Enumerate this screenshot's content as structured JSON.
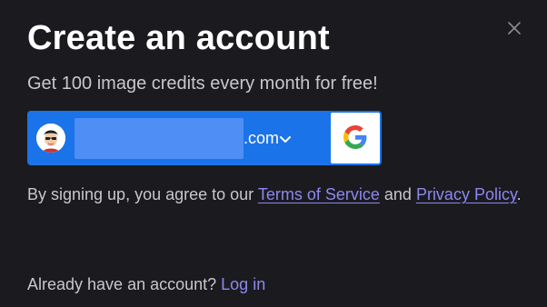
{
  "dialog": {
    "title": "Create an account",
    "subtitle": "Get 100 image credits every month for free!",
    "close_icon": "close-icon"
  },
  "google_signin": {
    "account_email_suffix": ".com",
    "avatar_icon": "user-avatar",
    "chevron_icon": "chevron-down-icon",
    "provider_icon": "google-logo-icon",
    "button_color": "#1a73e8"
  },
  "terms": {
    "prefix": "By signing up, you agree to our ",
    "terms_link": "Terms of Service",
    "middle": " and ",
    "privacy_link": "Privacy Policy",
    "suffix": "."
  },
  "login": {
    "prompt": "Already have an account? ",
    "link": "Log in"
  },
  "colors": {
    "background": "#1b1b1f",
    "link": "#8d87f0",
    "muted_text": "#c7c7cc"
  }
}
